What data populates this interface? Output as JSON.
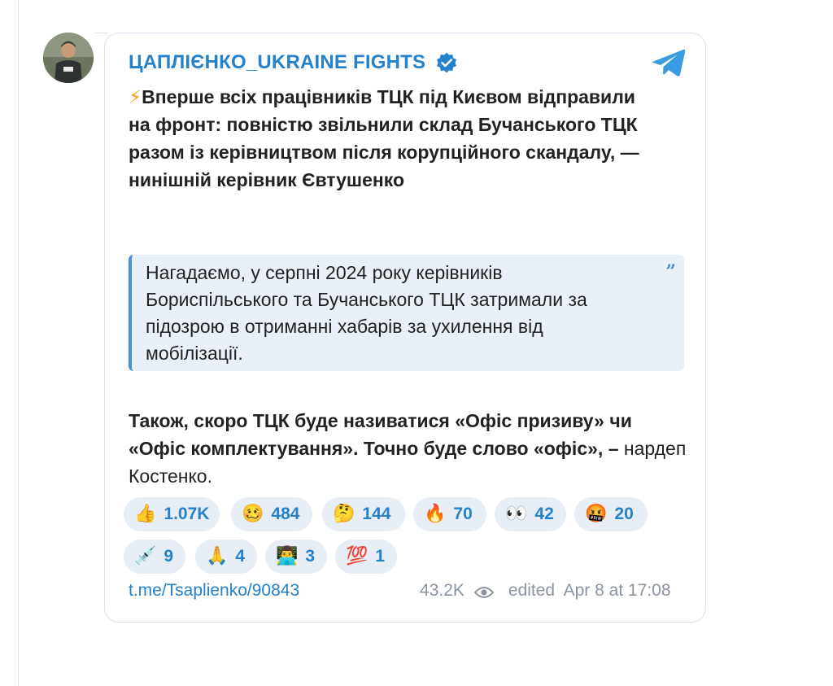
{
  "channel": {
    "name": "ЦАПЛІЄНКО_UKRAINE FIGHTS"
  },
  "post": {
    "headline": "Вперше всіх працівників ТЦК під Києвом відправили на фронт: повністю звільнили склад Бучанського ТЦК разом із керівництвом після корупційного скандалу, — нинішній керівник Євтушенко",
    "quote": "Нагадаємо, у серпні 2024 року керівників Бориспільського та Бучанського ТЦК затримали за підозрою в отриманні хабарів за ухилення від мобілізації.",
    "body_bold": "Також, скоро ТЦК буде називатися «Офіс призиву» чи «Офіс комплектування». Точно буде слово «офіс», –",
    "body_regular": " нардеп Костенко."
  },
  "reactions": [
    {
      "icon": "thumbs-up-icon",
      "glyph": "👍",
      "count": "1.07K"
    },
    {
      "icon": "woozy-face-icon",
      "glyph": "🥴",
      "count": "484"
    },
    {
      "icon": "thinking-face-icon",
      "glyph": "🤔",
      "count": "144"
    },
    {
      "icon": "fire-icon",
      "glyph": "🔥",
      "count": "70"
    },
    {
      "icon": "eyes-icon",
      "glyph": "👀",
      "count": "42"
    },
    {
      "icon": "cursing-face-icon",
      "glyph": "🤬",
      "count": "20"
    },
    {
      "icon": "syringe-icon",
      "glyph": "💉",
      "count": "9"
    },
    {
      "icon": "folded-hands-icon",
      "glyph": "🙏",
      "count": "4"
    },
    {
      "icon": "technologist-icon",
      "glyph": "👨‍💻",
      "count": "3"
    },
    {
      "icon": "hundred-points-icon",
      "glyph": "💯",
      "count": "1"
    }
  ],
  "footer": {
    "link": "t.me/Tsaplienko/90843",
    "views": "43.2K",
    "edited": "edited  Apr 8 at 17:08"
  },
  "colors": {
    "accent": "#2481cc",
    "quote_bar": "#4c8ed6",
    "quote_bg": "#eaf0f7",
    "reaction_bg": "#e7eef6",
    "verified": "#2481cc",
    "meta": "#8a94a1"
  }
}
